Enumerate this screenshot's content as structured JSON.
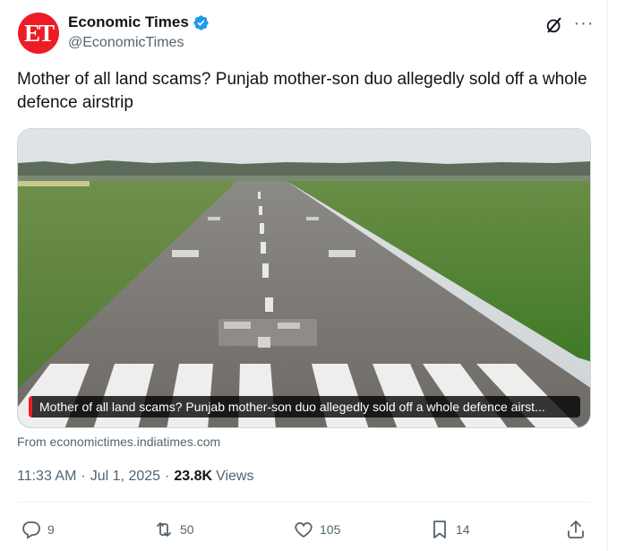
{
  "author": {
    "avatar_text": "ET",
    "name": "Economic Times",
    "handle": "@EconomicTimes",
    "verified": true,
    "avatar_color": "#ed1c24",
    "verified_color": "#1d9bf0"
  },
  "header_icons": {
    "grok": "grok-icon",
    "more": "more-icon",
    "more_glyph": "···"
  },
  "tweet": {
    "text": "Mother of all land scams? Punjab mother-son duo allegedly sold off a whole defence airstrip"
  },
  "media": {
    "caption": "Mother of all land scams? Punjab mother-son duo allegedly sold off a whole defence airst...",
    "description": "airstrip-photo"
  },
  "source": {
    "text": "From economictimes.indiatimes.com"
  },
  "meta": {
    "time": "11:33 AM",
    "separator": "·",
    "date": "Jul 1, 2025",
    "views_count": "23.8K",
    "views_label": "Views"
  },
  "actions": {
    "replies": "9",
    "reposts": "50",
    "likes": "105",
    "bookmarks": "14",
    "share": ""
  }
}
